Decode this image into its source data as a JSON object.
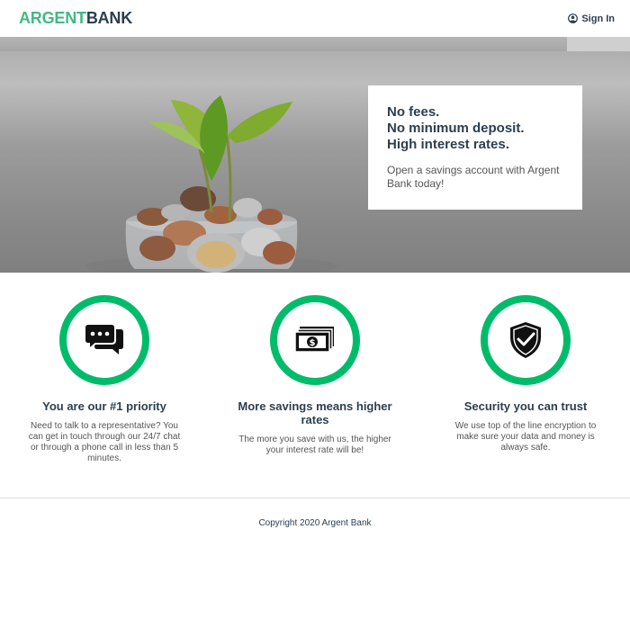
{
  "header": {
    "logo_part1": "ARGENT",
    "logo_part2": "BANK",
    "signin_label": "Sign In",
    "signin_icon": "user-circle-icon"
  },
  "hero": {
    "title_lines": [
      "No fees.",
      "No minimum deposit.",
      "High interest rates."
    ],
    "subtitle": "Open a savings account with Argent Bank today!"
  },
  "features": [
    {
      "icon": "chat-icon",
      "title": "You are our #1 priority",
      "text": "Need to talk to a representative? You can get in touch through our 24/7 chat or through a phone call in less than 5 minutes."
    },
    {
      "icon": "money-icon",
      "title": "More savings means higher rates",
      "text": "The more you save with us, the higher your interest rate will be!"
    },
    {
      "icon": "security-icon",
      "title": "Security you can trust",
      "text": "We use top of the line encryption to make sure your data and money is always safe."
    }
  ],
  "footer": {
    "copyright": "Copyright 2020 Argent Bank"
  },
  "colors": {
    "brand_green": "#42b983",
    "ring_green": "#00bc6a",
    "text_dark": "#2c3e50"
  }
}
